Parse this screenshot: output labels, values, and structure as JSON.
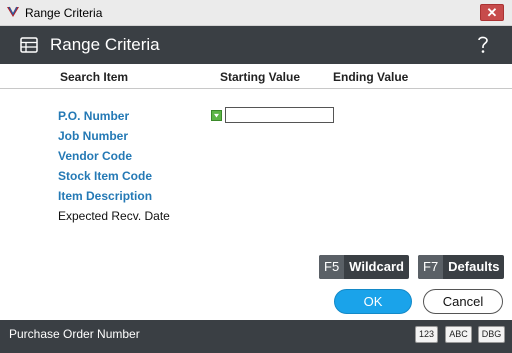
{
  "window": {
    "title": "Range Criteria",
    "close_glyph": "✕"
  },
  "header": {
    "title": "Range Criteria",
    "help_icon": "question-mark-icon"
  },
  "columns": {
    "search_item": "Search Item",
    "starting_value": "Starting Value",
    "ending_value": "Ending Value"
  },
  "fields": [
    {
      "label": "P.O. Number"
    },
    {
      "label": "Job Number"
    },
    {
      "label": "Vendor Code"
    },
    {
      "label": "Stock Item Code"
    },
    {
      "label": "Item Description"
    },
    {
      "label": "Expected Recv. Date"
    }
  ],
  "po_number": {
    "starting_value": ""
  },
  "function_keys": {
    "wildcard_key": "F5",
    "wildcard_label": "Wildcard",
    "defaults_key": "F7",
    "defaults_label": "Defaults"
  },
  "buttons": {
    "ok": "OK",
    "cancel": "Cancel"
  },
  "status": {
    "text": "Purchase Order Number",
    "badges": [
      "123",
      "ABC",
      "DBG"
    ]
  },
  "colors": {
    "header_bg": "#3a3f44",
    "accent_blue": "#1aa3ea",
    "field_link": "#2479b5",
    "close_red": "#c74b4b",
    "marker_green": "#5db546"
  }
}
